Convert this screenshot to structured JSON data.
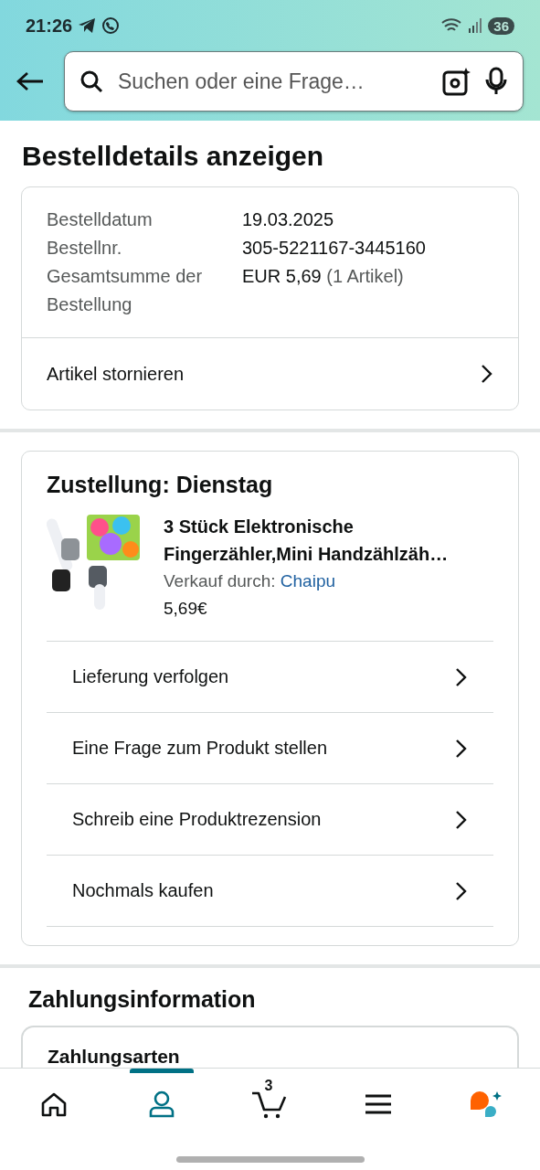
{
  "status_bar": {
    "time": "21:26",
    "battery": "36"
  },
  "search": {
    "placeholder": "Suchen oder eine Frage…"
  },
  "page_title": "Bestelldetails anzeigen",
  "order_summary": {
    "rows": [
      {
        "label": "Bestelldatum",
        "value": "19.03.2025"
      },
      {
        "label": "Bestellnr.",
        "value": "305-5221167-3445160"
      },
      {
        "label": "Gesamtsumme der Bestellung",
        "value": "EUR 5,69",
        "note": "(1 Artikel)"
      }
    ],
    "action": "Artikel stornieren"
  },
  "delivery": {
    "title": "Zustellung: Dienstag",
    "product": {
      "kind": "picture",
      "title": "3 Stück Elektronische Fingerzähler,Mini Handzählzäh…",
      "seller_label": "Verkauf durch:",
      "seller": "Chaipu",
      "price": "5,69€"
    },
    "actions": [
      "Lieferung verfolgen",
      "Eine Frage zum Produkt stellen",
      "Schreib eine Produktrezension",
      "Nochmals kaufen"
    ]
  },
  "payment": {
    "title": "Zahlungsinformation",
    "card_title": "Zahlungsarten"
  },
  "bottom_nav": [
    {
      "kind": "home",
      "selected": false
    },
    {
      "kind": "account",
      "selected": true
    },
    {
      "kind": "cart",
      "badge": "3",
      "selected": false
    },
    {
      "kind": "menu",
      "selected": false
    },
    {
      "kind": "assistant",
      "selected": false
    }
  ]
}
